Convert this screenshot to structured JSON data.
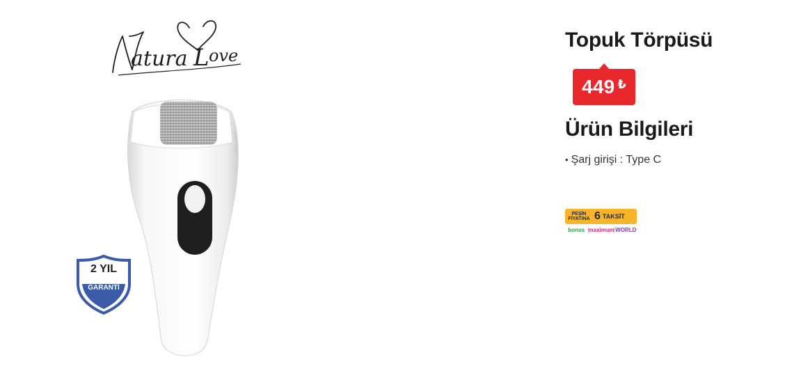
{
  "brand": {
    "logo_text": "NaturaLove",
    "icon": "heart-icon"
  },
  "product": {
    "title": "Topuk Törpüsü",
    "image": "foot-file-device-image"
  },
  "price": {
    "amount": "449",
    "currency": "₺",
    "color": "#e8282b"
  },
  "warranty": {
    "line1": "2 YIL",
    "line2": "GARANTİ",
    "color": "#3b5ba9"
  },
  "info": {
    "title": "Ürün Bilgileri",
    "items": [
      {
        "bullet": "•",
        "text": "Şarj girişi : Type C"
      }
    ]
  },
  "installment": {
    "top_small_1": "PEŞİN",
    "top_small_2": "FİYATINA",
    "number": "6",
    "word": "TAKSİT",
    "cards": [
      "bonus",
      "maximum",
      "WORLD"
    ],
    "color": "#f7b52c"
  }
}
